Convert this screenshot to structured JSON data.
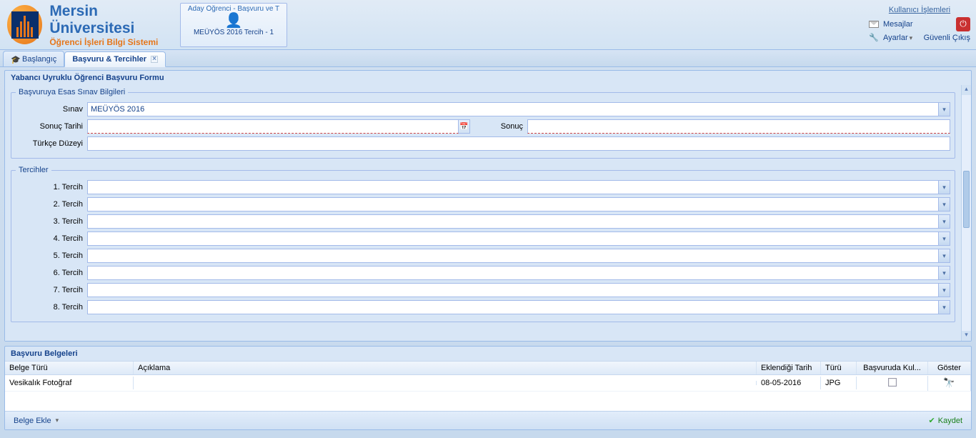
{
  "header": {
    "uni_name": "Mersin Üniversitesi",
    "system_name": "Öğrenci İşleri Bilgi Sistemi",
    "portlet_title": "Aday Öğrenci - Başvuru ve T",
    "portlet_sub": "MEÜYÖS 2016 Tercih - 1",
    "user_ops_title": "Kullanıcı İşlemleri",
    "messages": "Mesajlar",
    "settings": "Ayarlar",
    "safe_logout": "Güvenli Çıkış"
  },
  "tabs": {
    "start": "Başlangıç",
    "apply": "Başvuru & Tercihler"
  },
  "form": {
    "title": "Yabancı Uyruklu Öğrenci Başvuru Formu",
    "exam_section": "Başvuruya Esas Sınav Bilgileri",
    "label_exam": "Sınav",
    "exam_value": "MEÜYÖS 2016",
    "label_result_date": "Sonuç Tarihi",
    "result_date_value": "",
    "label_result": "Sonuç",
    "result_value": "",
    "label_tr_level": "Türkçe Düzeyi",
    "tr_level_value": "",
    "pref_section": "Tercihler",
    "pref_labels": [
      "1. Tercih",
      "2. Tercih",
      "3. Tercih",
      "4. Tercih",
      "5. Tercih",
      "6. Tercih",
      "7. Tercih",
      "8. Tercih"
    ]
  },
  "docs": {
    "title": "Başvuru Belgeleri",
    "headers": {
      "type": "Belge Türü",
      "desc": "Açıklama",
      "date": "Eklendiği Tarih",
      "ftype": "Türü",
      "used": "Başvuruda Kul...",
      "show": "Göster"
    },
    "rows": [
      {
        "type": "Vesikalık Fotoğraf",
        "desc": "",
        "date": "08-05-2016",
        "ftype": "JPG"
      }
    ],
    "add_doc": "Belge Ekle",
    "save": "Kaydet"
  }
}
